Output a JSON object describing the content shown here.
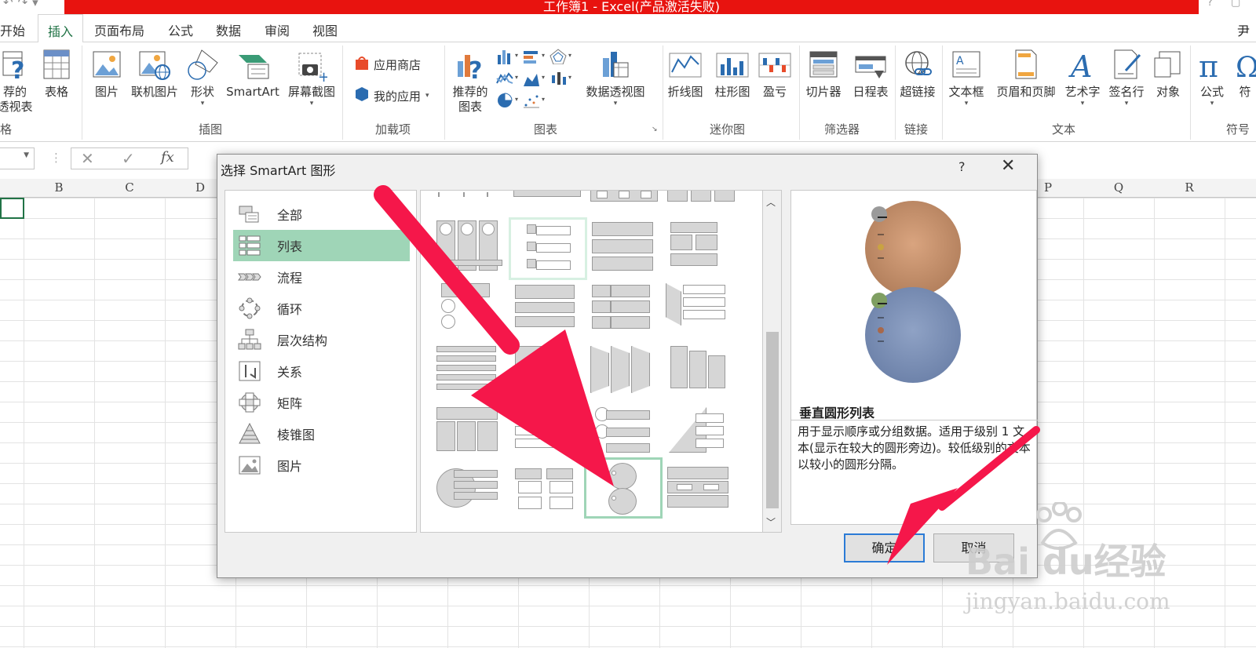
{
  "window": {
    "title": "工作簿1 -  Excel(产品激活失败)"
  },
  "ribbon": {
    "tabs": [
      {
        "label": "开始"
      },
      {
        "label": "插入",
        "active": true
      },
      {
        "label": "页面布局"
      },
      {
        "label": "公式"
      },
      {
        "label": "数据"
      },
      {
        "label": "审阅"
      },
      {
        "label": "视图"
      }
    ],
    "user": "尹",
    "buttons": {
      "recommended_pivot_line1": "荐的",
      "recommended_pivot_line2": "透视表",
      "table": "表格",
      "picture": "图片",
      "online_picture": "联机图片",
      "shapes": "形状",
      "smartart": "SmartArt",
      "screenshot": "屏幕截图",
      "app_store": "应用商店",
      "my_apps": "我的应用",
      "recommended_charts_line1": "推荐的",
      "recommended_charts_line2": "图表",
      "pivot_chart": "数据透视图",
      "sparkline_line": "折线图",
      "sparkline_column": "柱形图",
      "sparkline_winloss": "盈亏",
      "slicer": "切片器",
      "timeline": "日程表",
      "hyperlink": "超链接",
      "textbox": "文本框",
      "header_footer": "页眉和页脚",
      "wordart": "艺术字",
      "signature": "签名行",
      "object": "对象",
      "equation": "公式",
      "symbol": "符"
    },
    "groups": {
      "tables": "格",
      "illustrations": "插图",
      "addins": "加载项",
      "charts": "图表",
      "sparklines": "迷你图",
      "filters": "筛选器",
      "links": "链接",
      "text": "文本",
      "symbols": "符号"
    }
  },
  "formula_bar": {
    "fx": "fx"
  },
  "sheet": {
    "columns": [
      "B",
      "C",
      "D",
      "P",
      "Q",
      "R"
    ]
  },
  "dialog": {
    "title": "选择 SmartArt 图形",
    "help": "?",
    "categories": [
      {
        "label": "全部"
      },
      {
        "label": "列表",
        "selected": true
      },
      {
        "label": "流程"
      },
      {
        "label": "循环"
      },
      {
        "label": "层次结构"
      },
      {
        "label": "关系"
      },
      {
        "label": "矩阵"
      },
      {
        "label": "棱锥图"
      },
      {
        "label": "图片"
      }
    ],
    "preview": {
      "name": "垂直圆形列表",
      "description": "用于显示顺序或分组数据。适用于级别 1 文本(显示在较大的圆形旁边)。较低级别的文本以较小的圆形分隔。",
      "colors": {
        "top_circle": "#c8906a",
        "bottom_circle": "#7f93b8"
      }
    },
    "ok_label": "确定",
    "cancel_label": "取消"
  },
  "watermark": {
    "brand": "Bai  du经验",
    "url": "jingyan.baidu.com"
  },
  "colors": {
    "accent": "#217346",
    "selection": "#9fd5b7",
    "title_red": "#e8130f",
    "annotation_arrow": "#f5174a"
  }
}
